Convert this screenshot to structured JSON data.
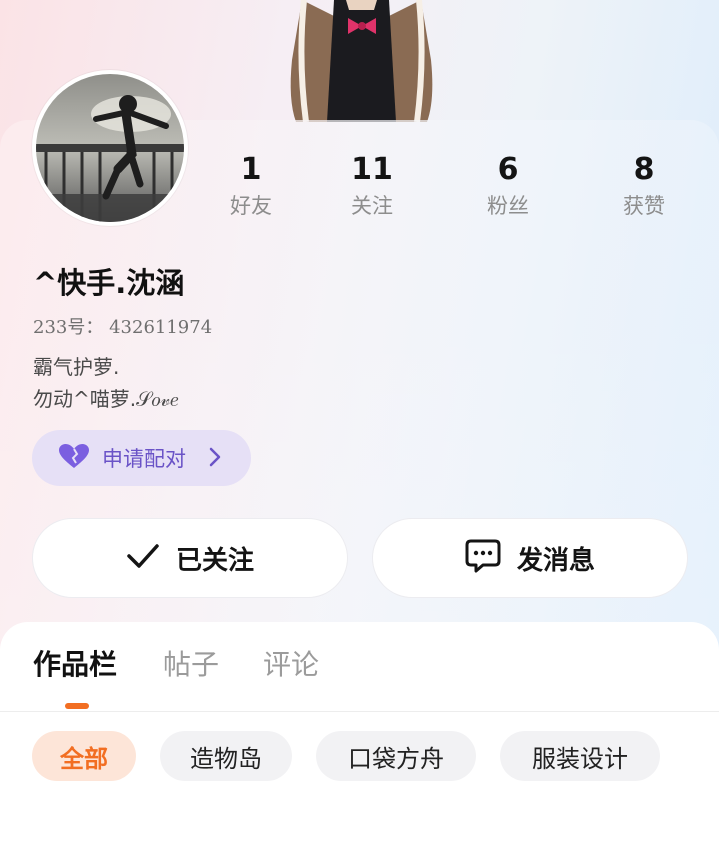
{
  "profile": {
    "username": "^快手.沈涵",
    "id_label": "233号：",
    "id_value": "432611974",
    "bio_lines": [
      "霸气护萝.",
      "勿动^喵萝.𝒮𝑜𝓋𝑒"
    ],
    "stats": [
      {
        "value": "1",
        "label": "好友"
      },
      {
        "value": "11",
        "label": "关注"
      },
      {
        "value": "6",
        "label": "粉丝"
      },
      {
        "value": "8",
        "label": "获赞"
      }
    ],
    "match_button": "申请配对"
  },
  "actions": {
    "follow_label": "已关注",
    "message_label": "发消息"
  },
  "tabs": [
    {
      "label": "作品栏",
      "active": true
    },
    {
      "label": "帖子",
      "active": false
    },
    {
      "label": "评论",
      "active": false
    }
  ],
  "filters": [
    {
      "label": "全部",
      "active": true
    },
    {
      "label": "造物岛",
      "active": false
    },
    {
      "label": "口袋方舟",
      "active": false
    },
    {
      "label": "服装设计",
      "active": false
    }
  ],
  "colors": {
    "accent": "#f26e22",
    "match_purple": "#6a53c7",
    "match_bg": "#e6e0f6"
  },
  "icons": [
    "heart-icon",
    "chevron-right-icon",
    "check-icon",
    "chat-bubble-icon"
  ]
}
